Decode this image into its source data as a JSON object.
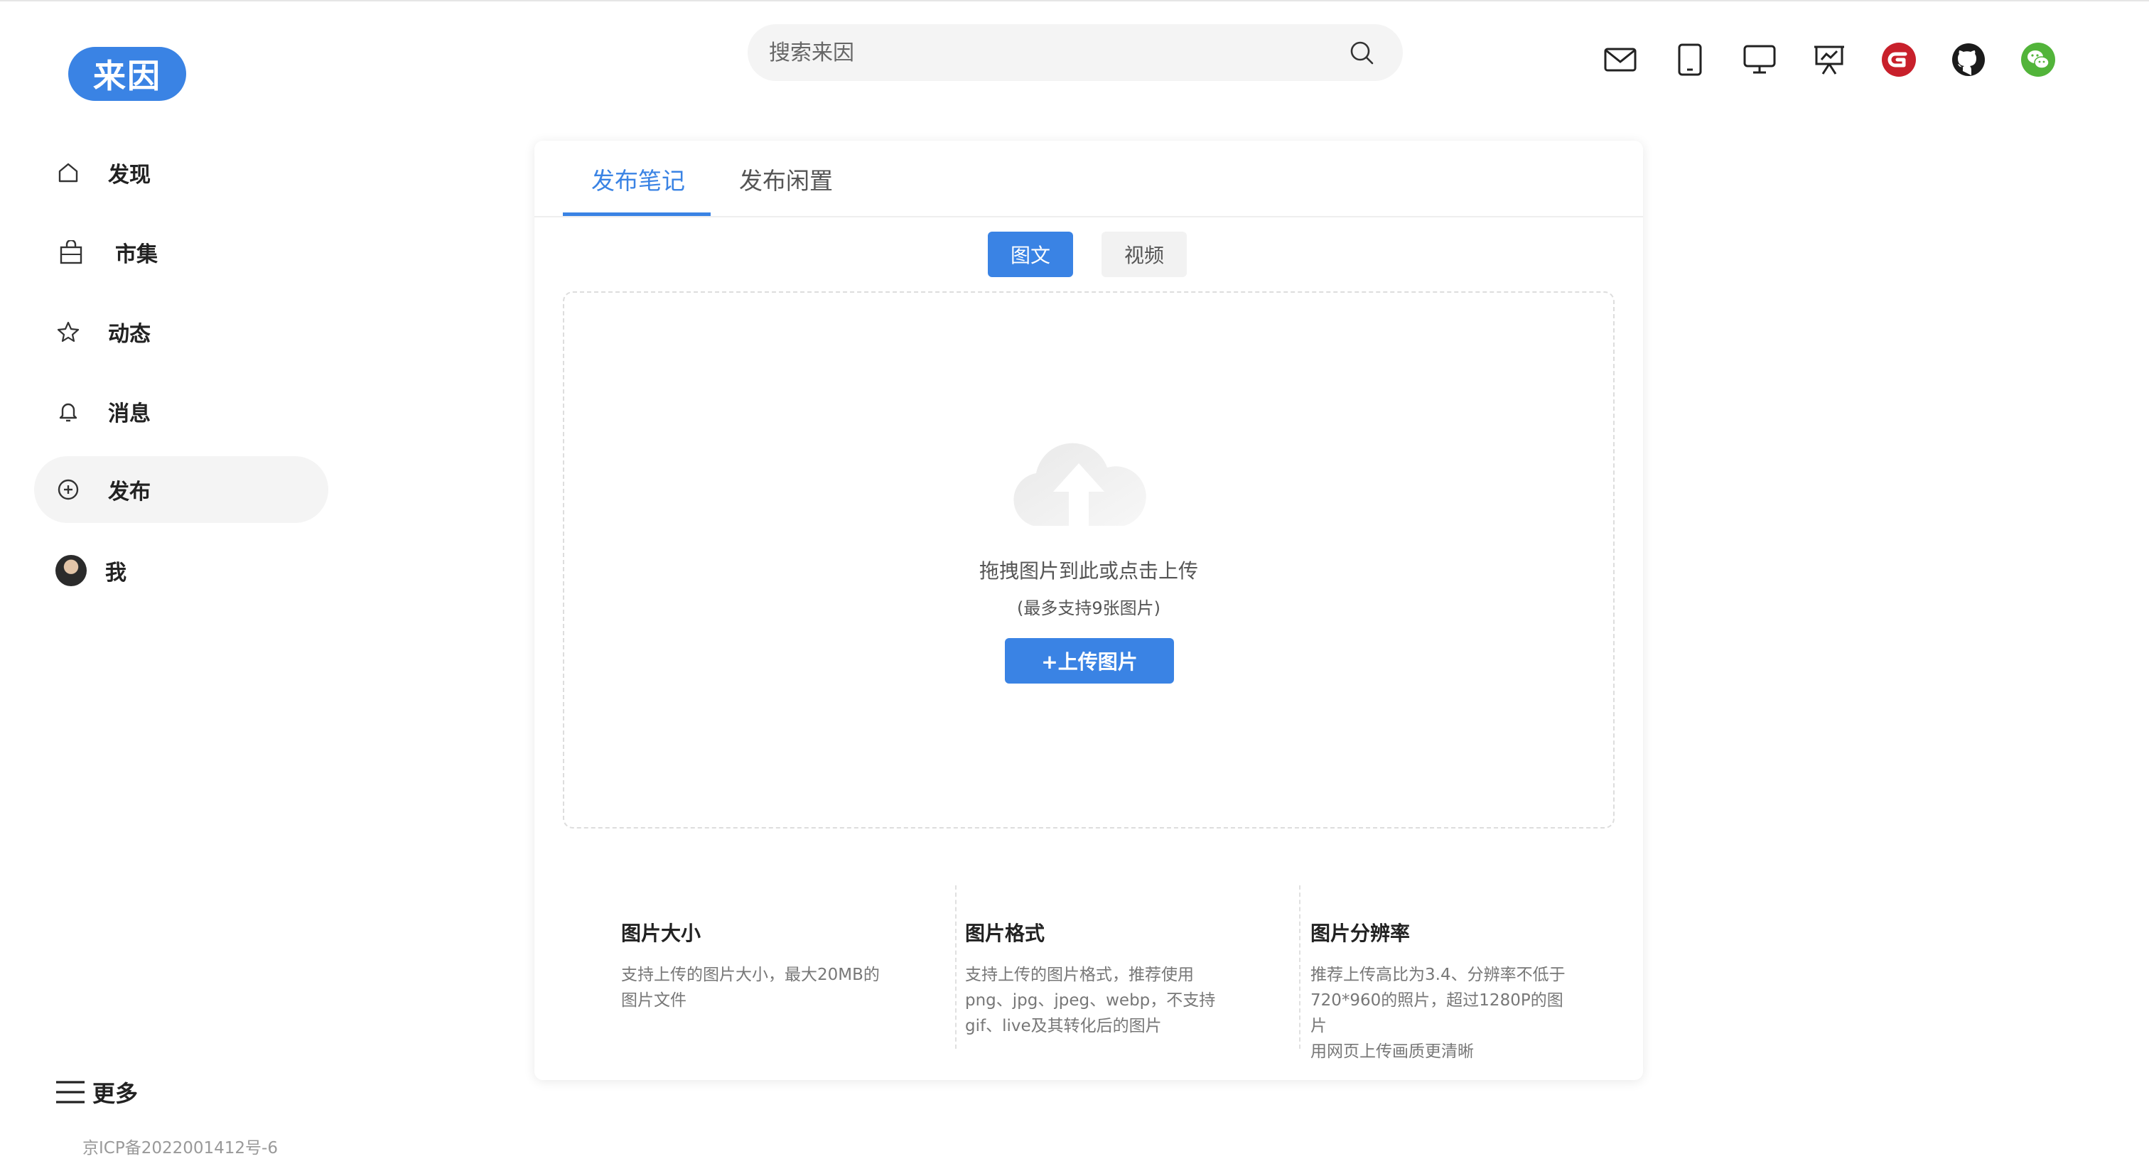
{
  "brand": {
    "logo_text": "来因",
    "accent": "#3a83e4"
  },
  "search": {
    "placeholder": "搜索来因"
  },
  "header_icons": [
    "mail-icon",
    "tablet-icon",
    "monitor-icon",
    "presentation-icon",
    "g-brand-icon",
    "github-icon",
    "wechat-icon"
  ],
  "sidebar": {
    "items": [
      {
        "label": "发现",
        "icon": "home-icon"
      },
      {
        "label": "市集",
        "icon": "shopping-bag-icon"
      },
      {
        "label": "动态",
        "icon": "star-icon"
      },
      {
        "label": "消息",
        "icon": "bell-icon"
      },
      {
        "label": "发布",
        "icon": "plus-circle-icon",
        "active": true
      },
      {
        "label": "我",
        "icon": "avatar"
      }
    ],
    "more_label": "更多",
    "icp": "京ICP备2022001412号-6"
  },
  "publish": {
    "tabs": [
      {
        "label": "发布笔记",
        "active": true
      },
      {
        "label": "发布闲置",
        "active": false
      }
    ],
    "segments": [
      {
        "label": "图文",
        "active": true
      },
      {
        "label": "视频",
        "active": false
      }
    ],
    "dropzone": {
      "main_text": "拖拽图片到此或点击上传",
      "sub_text": "(最多支持9张图片)",
      "button_label": "+上传图片"
    },
    "tips": [
      {
        "title": "图片大小",
        "lines": [
          "支持上传的图片大小，最大20MB的",
          "图片文件"
        ]
      },
      {
        "title": "图片格式",
        "lines": [
          "支持上传的图片格式，推荐使用",
          "png、jpg、jpeg、webp，不支持",
          "gif、live及其转化后的图片"
        ]
      },
      {
        "title": "图片分辨率",
        "lines": [
          "推荐上传高比为3.4、分辨率不低于",
          "720*960的照片，超过1280P的图片",
          "用网页上传画质更清晰"
        ]
      }
    ]
  }
}
